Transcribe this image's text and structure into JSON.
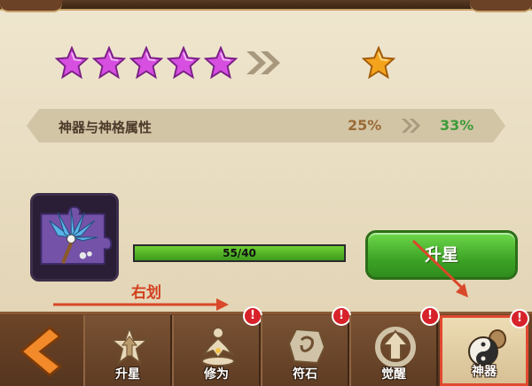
{
  "stars": {
    "current_count": 5,
    "next_count": 1,
    "current_color": "#d64fe0",
    "next_color": "#f4a31d"
  },
  "attribute": {
    "label": "神器与神格属性",
    "from": "25%",
    "to": "33%"
  },
  "item": {
    "icon": "feather-puzzle-artifact-icon"
  },
  "progress": {
    "text": "55/40",
    "fraction": 1.0
  },
  "upgrade": {
    "label": "升星",
    "color": "#3da426"
  },
  "annotation": {
    "text": "右划"
  },
  "tabs": [
    {
      "label": "升星",
      "icon": "star-up-icon",
      "badge": ""
    },
    {
      "label": "修为",
      "icon": "meditation-icon",
      "badge": "!"
    },
    {
      "label": "符石",
      "icon": "rune-stone-icon",
      "badge": "!"
    },
    {
      "label": "觉醒",
      "icon": "awaken-arrow-icon",
      "badge": "!"
    },
    {
      "label": "神器",
      "icon": "yin-yang-gourd-icon",
      "badge": "!"
    }
  ],
  "active_tab": 4,
  "back": {
    "icon": "chevron-left-icon"
  }
}
